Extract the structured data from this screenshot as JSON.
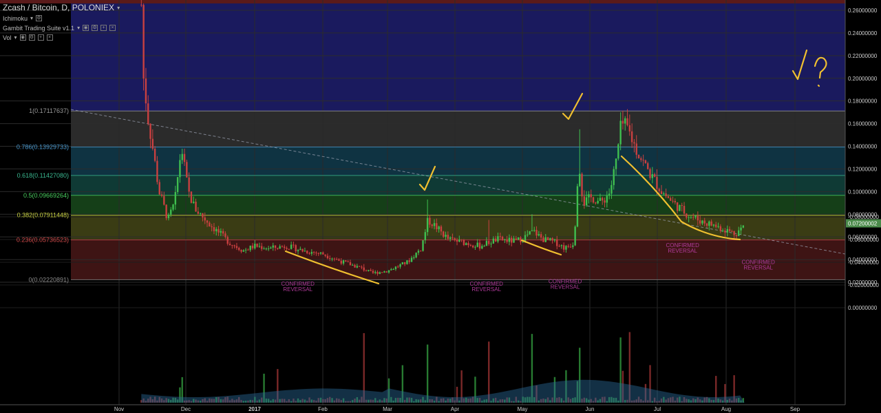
{
  "header": {
    "symbol_title": "Zcash / Bitcoin, D, POLONIEX",
    "indicators": [
      {
        "label": "Ichimoku"
      },
      {
        "label": "Gambit Trading Suite v1.1"
      },
      {
        "label": "Vol"
      }
    ]
  },
  "price_tag": "0.07200002",
  "colors": {
    "background": "#000000",
    "up": "#3fbf4f",
    "down": "#c94040",
    "annotation": "#f0c030",
    "confirmed": "#b03a9a"
  },
  "chart_data": {
    "type": "candlestick",
    "xaxis_ticks": [
      "Nov",
      "Dec",
      "2017",
      "Feb",
      "Mar",
      "Apr",
      "May",
      "Jun",
      "Jul",
      "Aug",
      "Sep"
    ],
    "price_axis_ticks": [
      "0.26000000",
      "0.24000000",
      "0.22000000",
      "0.20000000",
      "0.18000000",
      "0.16000000",
      "0.14000000",
      "0.12000000",
      "0.10000000",
      "0.08000000",
      "0.06000000",
      "0.04000000",
      "0.02000000"
    ],
    "volume_axis_ticks": [
      "0.00000000",
      "-0.02000000",
      "-0.04000000",
      "-0.06000000",
      "-0.08000000"
    ],
    "fib_levels": [
      {
        "label": "1(0.17117637)",
        "value": 0.17117637
      },
      {
        "label": "0.786(0.13929733)",
        "value": 0.13929733
      },
      {
        "label": "0.618(0.11427080)",
        "value": 0.1142708
      },
      {
        "label": "0.5(0.09669264)",
        "value": 0.09669264
      },
      {
        "label": "0.382(0.07911448)",
        "value": 0.07911448
      },
      {
        "label": "0.236(0.05736523)",
        "value": 0.05736523
      },
      {
        "label": "0(0.02220891)",
        "value": 0.02220891
      }
    ],
    "annotations": [
      {
        "text": "CONFIRMED\nREVERSAL",
        "date": "Jan 20",
        "price": 0.017
      },
      {
        "text": "CONFIRMED\nREVERSAL",
        "date": "Apr 15",
        "price": 0.017
      },
      {
        "text": "CONFIRMED\nREVERSAL",
        "date": "May 20",
        "price": 0.019
      },
      {
        "text": "CONFIRMED\nREVERSAL",
        "date": "Jul 12",
        "price": 0.051
      },
      {
        "text": "CONFIRMED\nREVERSAL",
        "date": "Aug 15",
        "price": 0.036
      }
    ],
    "handwritten": [
      "√",
      "√",
      "√",
      "√?"
    ]
  }
}
